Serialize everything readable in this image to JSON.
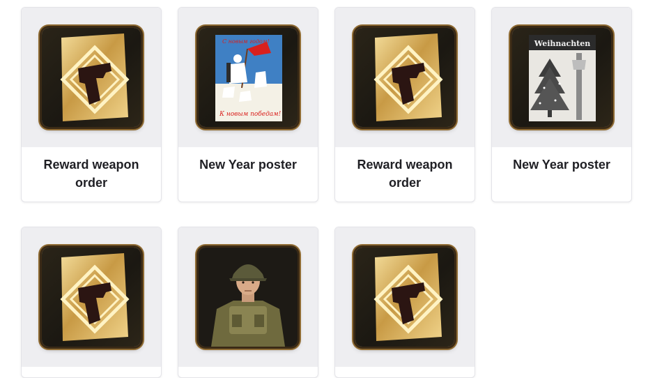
{
  "items": [
    {
      "title": "Reward weapon order",
      "icon": "pistol-order-icon"
    },
    {
      "title": "New Year poster",
      "icon": "soviet-poster-icon"
    },
    {
      "title": "Reward weapon order",
      "icon": "pistol-order-icon"
    },
    {
      "title": "New Year poster",
      "icon": "weihnachten-poster-icon"
    },
    {
      "title": "",
      "icon": "pistol-order-icon"
    },
    {
      "title": "",
      "icon": "soldier-portrait-icon"
    },
    {
      "title": "",
      "icon": "pistol-order-icon"
    }
  ],
  "posters": {
    "soviet_top_text": "С новым годом!",
    "soviet_bottom_text": "К новым победам!",
    "german_title": "Weihnachten"
  },
  "colors": {
    "card_border": "#e3e3e8",
    "thumb_bg": "#eeeef1",
    "gold": "#d9b45a",
    "frame_dark": "#1b1812"
  }
}
